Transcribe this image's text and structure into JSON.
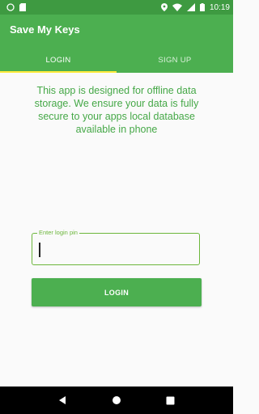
{
  "status_bar": {
    "time": "10:19",
    "background": "#3e9a41",
    "left_icons": [
      "circle-notification-icon",
      "sd-card-icon"
    ],
    "right_icons": [
      "location-icon",
      "wifi-icon",
      "cell-signal-icon",
      "battery-icon"
    ]
  },
  "app_bar": {
    "title": "Save My Keys",
    "background": "#4caf50"
  },
  "tabs": [
    {
      "label": "LOGIN",
      "active": true
    },
    {
      "label": "SIGN UP",
      "active": false
    }
  ],
  "tab_indicator_color": "#ffeb3b",
  "main": {
    "info_text": "This app is designed for offline data storage. We ensure your data is fully secure to your apps local database available in phone",
    "pin_field": {
      "label": "Enter login pin",
      "value": ""
    },
    "login_button_label": "LOGIN",
    "accent_color": "#4caf50"
  },
  "nav_bar": {
    "icons": [
      "back-icon",
      "home-icon",
      "recents-icon"
    ]
  }
}
